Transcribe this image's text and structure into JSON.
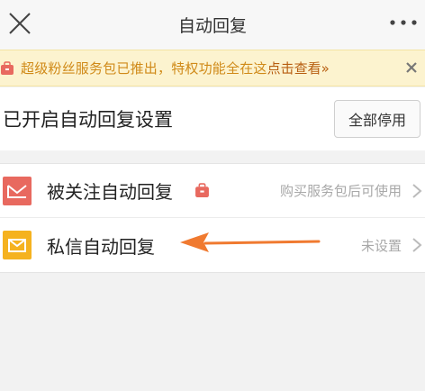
{
  "header": {
    "title": "自动回复"
  },
  "banner": {
    "text": "超级粉丝服务包已推出，特权功能全在这",
    "link": "点击查看»"
  },
  "status": {
    "label": "已开启自动回复设置",
    "button": "全部停用"
  },
  "list": [
    {
      "name": "被关注自动回复",
      "right": "购买服务包后可使用"
    },
    {
      "name": "私信自动回复",
      "right": "未设置"
    }
  ],
  "colors": {
    "accent_orange": "#f07a30",
    "banner_bg": "#fcf3cf",
    "icon_red": "#e8695f",
    "icon_yellow": "#f5b21f"
  }
}
